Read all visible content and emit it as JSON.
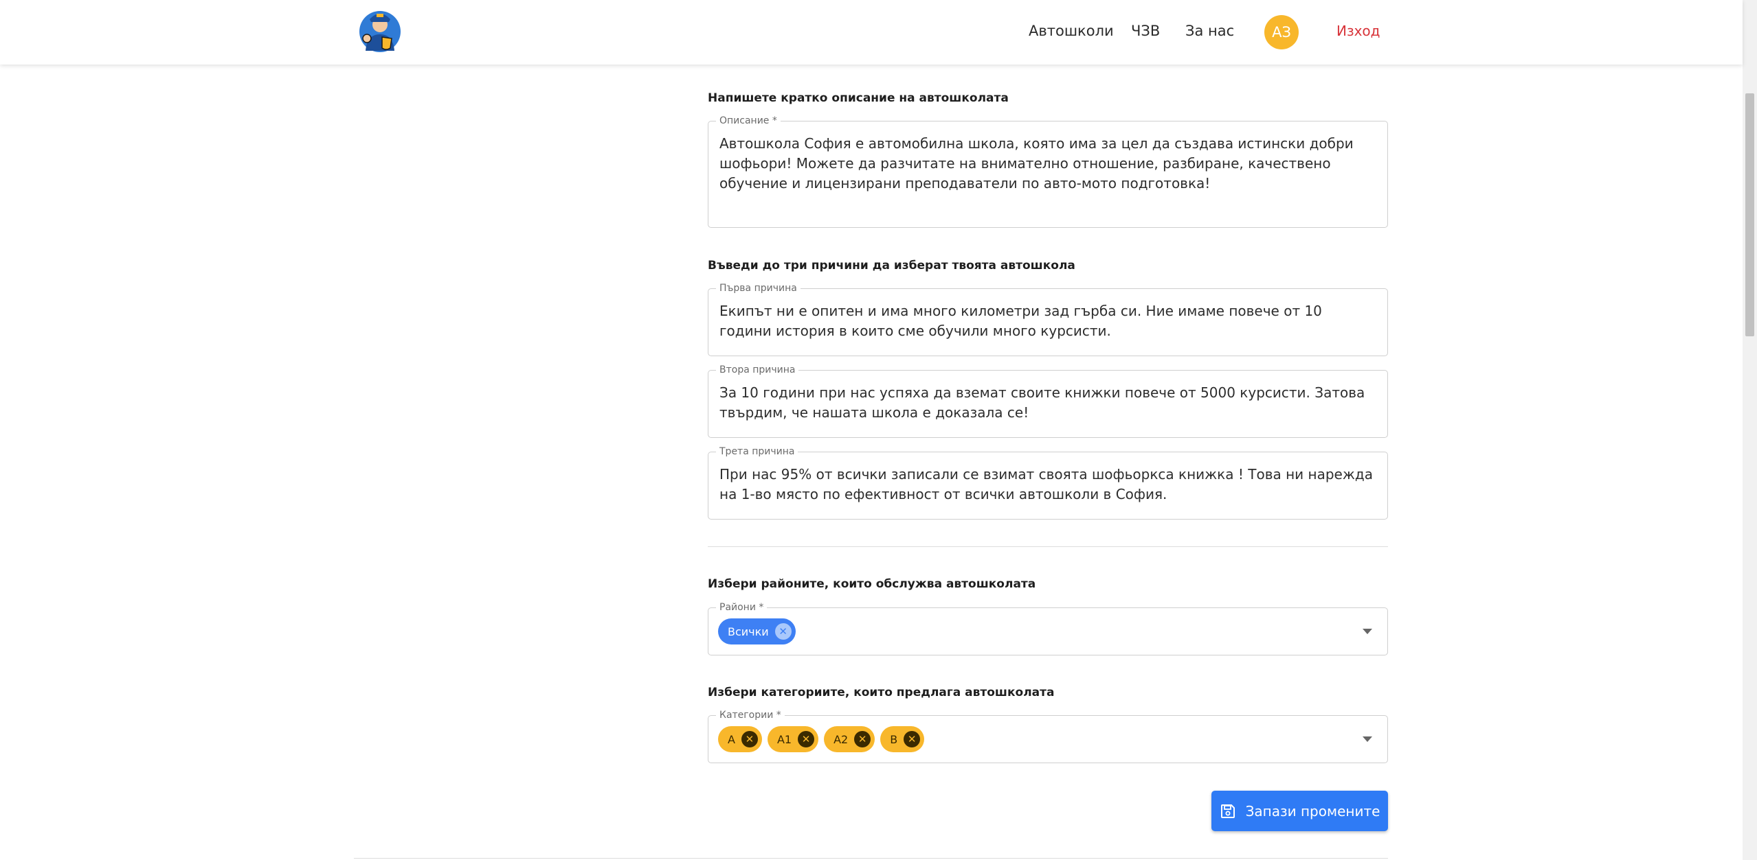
{
  "nav": {
    "links": [
      "Автошколи",
      "ЧЗВ",
      "За нас"
    ],
    "avatar_initials": "АЗ",
    "logout": "Изход"
  },
  "description": {
    "heading": "Напишете кратко описание на автошколата",
    "label": "Описание *",
    "value": "Автошкола София е автомобилна школа, която има за цел да създава истински добри шофьори! Можете да разчитате на внимателно отношение, разбиране, качествено обучение и лицензирани преподаватели по авто-мото подготовка!"
  },
  "reasons": {
    "heading": "Въведи до три причини да изберат твоята автошкола",
    "fields": [
      {
        "label": "Първа причина",
        "value": "Екипът ни е опитен и има много километри зад гърба си. Ние имаме повече от 10 години история в които сме обучили много курсисти."
      },
      {
        "label": "Втора причина",
        "value": "За 10 години при нас успяха да вземат своите книжки повече от 5000 курсисти. Затова твърдим, че нашата школа е доказала се!"
      },
      {
        "label": "Трета причина",
        "value": "При нас 95% от всички записали се взимат своята шофьоркса книжка ! Това ни нарежда на 1-во място по ефективност от всички автошколи в София."
      }
    ]
  },
  "districts": {
    "heading": "Избери районите, които обслужва автошколата",
    "label": "Райони *",
    "chips": [
      "Всички"
    ]
  },
  "categories": {
    "heading": "Избери категориите, които предлага автошколата",
    "label": "Категории *",
    "chips": [
      "A",
      "A1",
      "A2",
      "B"
    ]
  },
  "save_button": "Запази промените",
  "colors": {
    "accent_blue": "#2f7bf5",
    "chip_yellow": "#f8b72b",
    "logout_red": "#d8343a"
  }
}
